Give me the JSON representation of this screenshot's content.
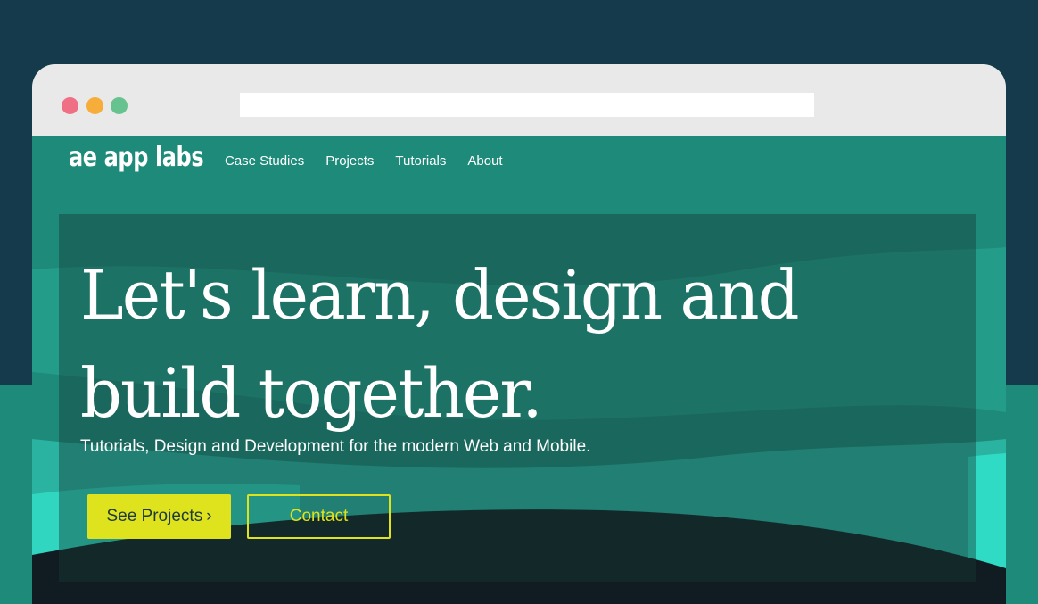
{
  "site": {
    "logo": "ae app labs",
    "nav": [
      "Case Studies",
      "Projects",
      "Tutorials",
      "About"
    ]
  },
  "hero": {
    "headline": "Let's learn, design and build together.",
    "tagline": "Tutorials, Design and Development for the modern Web and Mobile.",
    "primary_button": "See Projects",
    "primary_button_icon": "chevron-right-icon",
    "secondary_button": "Contact"
  },
  "colors": {
    "page_background": "#143a4c",
    "site_background": "#1e8a7a",
    "accent": "#dfe31d",
    "window_dot_red": "#ef6f84",
    "window_dot_yellow": "#f6ad3a",
    "window_dot_green": "#66c28e"
  }
}
